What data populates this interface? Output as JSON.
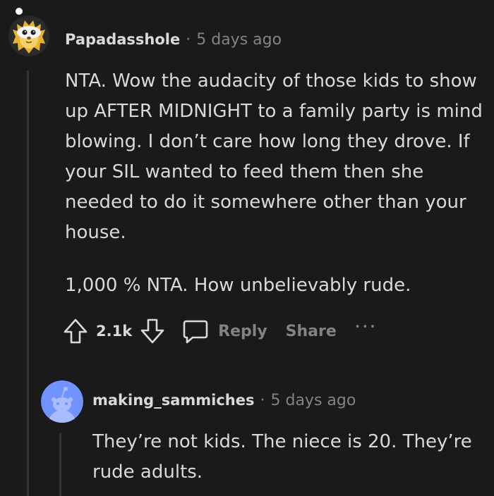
{
  "comment": {
    "author": "Papadasshole",
    "separator": "·",
    "timestamp": "5 days ago",
    "paragraphs": [
      "NTA. Wow the audacity of those kids to show up AFTER MIDNIGHT to a family party is mind blowing. I don’t care how long they drove. If your SIL wanted to feed them then she needed to do it somewhere other than your house.",
      "1,000 % NTA. How unbelievably rude."
    ],
    "score": "2.1k",
    "reply_label": "Reply",
    "share_label": "Share",
    "more_label": "•••"
  },
  "reply": {
    "author": "making_sammiches",
    "separator": "·",
    "timestamp": "5 days ago",
    "body": "They’re not kids. The niece is 20. They’re rude adults."
  },
  "colors": {
    "background": "#1a1a1b",
    "text": "#d7dadc",
    "muted": "#818384",
    "thread_line": "#343536",
    "avatar_blue": "#7193ff"
  }
}
